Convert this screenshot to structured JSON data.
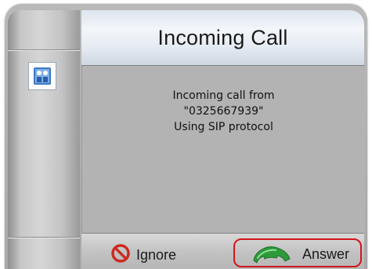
{
  "dialog": {
    "title": "Incoming Call",
    "message_lines": [
      "Incoming call from",
      "\"0325667939\"",
      "Using SIP protocol"
    ]
  },
  "buttons": {
    "ignore_label": "Ignore",
    "answer_label": "Answer"
  },
  "icons": {
    "app": "app-icon",
    "ignore": "no-entry-icon",
    "answer": "phone-handset-icon"
  },
  "colors": {
    "highlight_border": "#d4141c",
    "ignore_icon": "#cc2a1e",
    "answer_icon": "#2e9a3a"
  }
}
